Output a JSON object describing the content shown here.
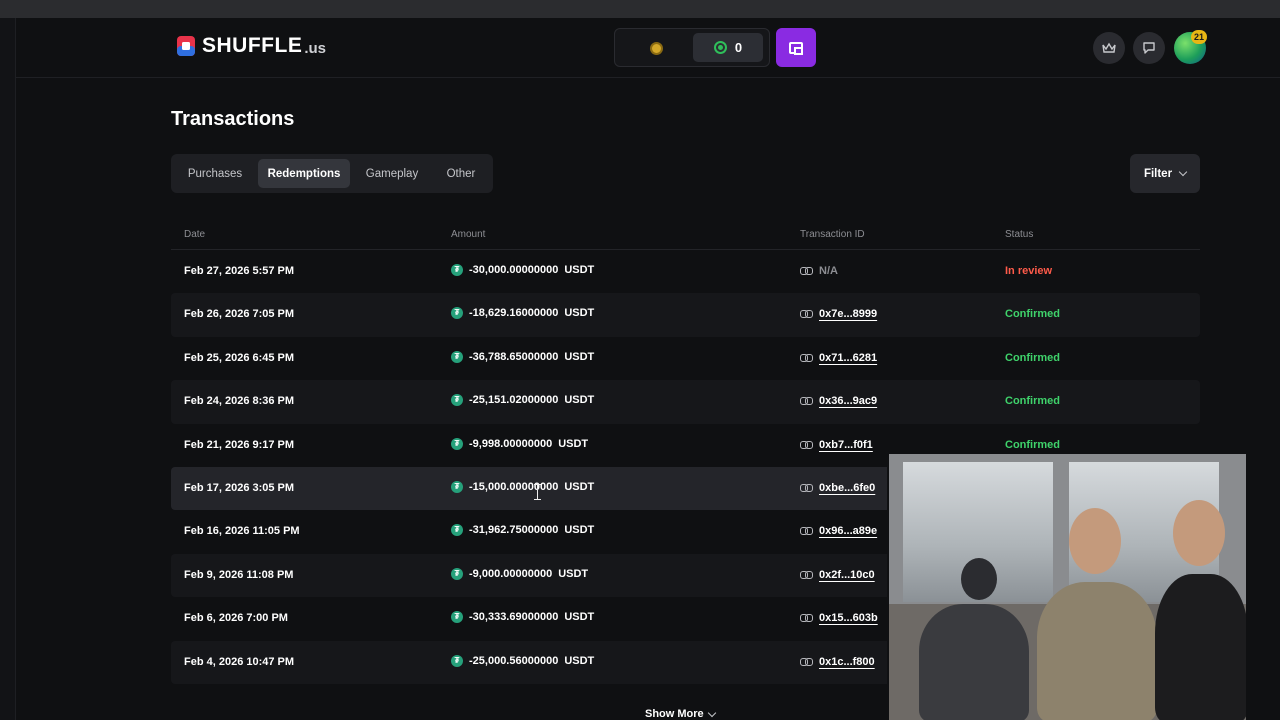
{
  "header": {
    "logo_text": "SHUFFLE",
    "logo_suffix": ".us",
    "sc_balance": "0",
    "notification_count": "21"
  },
  "page": {
    "title": "Transactions"
  },
  "tabs": [
    {
      "label": "Purchases",
      "active": false
    },
    {
      "label": "Redemptions",
      "active": true
    },
    {
      "label": "Gameplay",
      "active": false
    },
    {
      "label": "Other",
      "active": false
    }
  ],
  "filter_label": "Filter",
  "table": {
    "columns": [
      "Date",
      "Amount",
      "Transaction ID",
      "Status"
    ],
    "currency": "USDT",
    "rows": [
      {
        "date": "Feb 27, 2026 5:57 PM",
        "amount": "-30,000.00000000",
        "tx": "N/A",
        "status": "In review"
      },
      {
        "date": "Feb 26, 2026 7:05 PM",
        "amount": "-18,629.16000000",
        "tx": "0x7e...8999",
        "status": "Confirmed"
      },
      {
        "date": "Feb 25, 2026 6:45 PM",
        "amount": "-36,788.65000000",
        "tx": "0x71...6281",
        "status": "Confirmed"
      },
      {
        "date": "Feb 24, 2026 8:36 PM",
        "amount": "-25,151.02000000",
        "tx": "0x36...9ac9",
        "status": "Confirmed"
      },
      {
        "date": "Feb 21, 2026 9:17 PM",
        "amount": "-9,998.00000000",
        "tx": "0xb7...f0f1",
        "status": "Confirmed"
      },
      {
        "date": "Feb 17, 2026 3:05 PM",
        "amount": "-15,000.00000000",
        "tx": "0xbe...6fe0",
        "status": ""
      },
      {
        "date": "Feb 16, 2026 11:05 PM",
        "amount": "-31,962.75000000",
        "tx": "0x96...a89e",
        "status": ""
      },
      {
        "date": "Feb 9, 2026 11:08 PM",
        "amount": "-9,000.00000000",
        "tx": "0x2f...10c0",
        "status": ""
      },
      {
        "date": "Feb 6, 2026 7:00 PM",
        "amount": "-30,333.69000000",
        "tx": "0x15...603b",
        "status": ""
      },
      {
        "date": "Feb 4, 2026 10:47 PM",
        "amount": "-25,000.56000000",
        "tx": "0x1c...f800",
        "status": ""
      }
    ]
  },
  "show_more_label": "Show More",
  "colors": {
    "accent_purple": "#8a2be2",
    "confirmed": "#3fd36b",
    "in_review": "#ff5b4a",
    "usdt": "#26a17b"
  }
}
